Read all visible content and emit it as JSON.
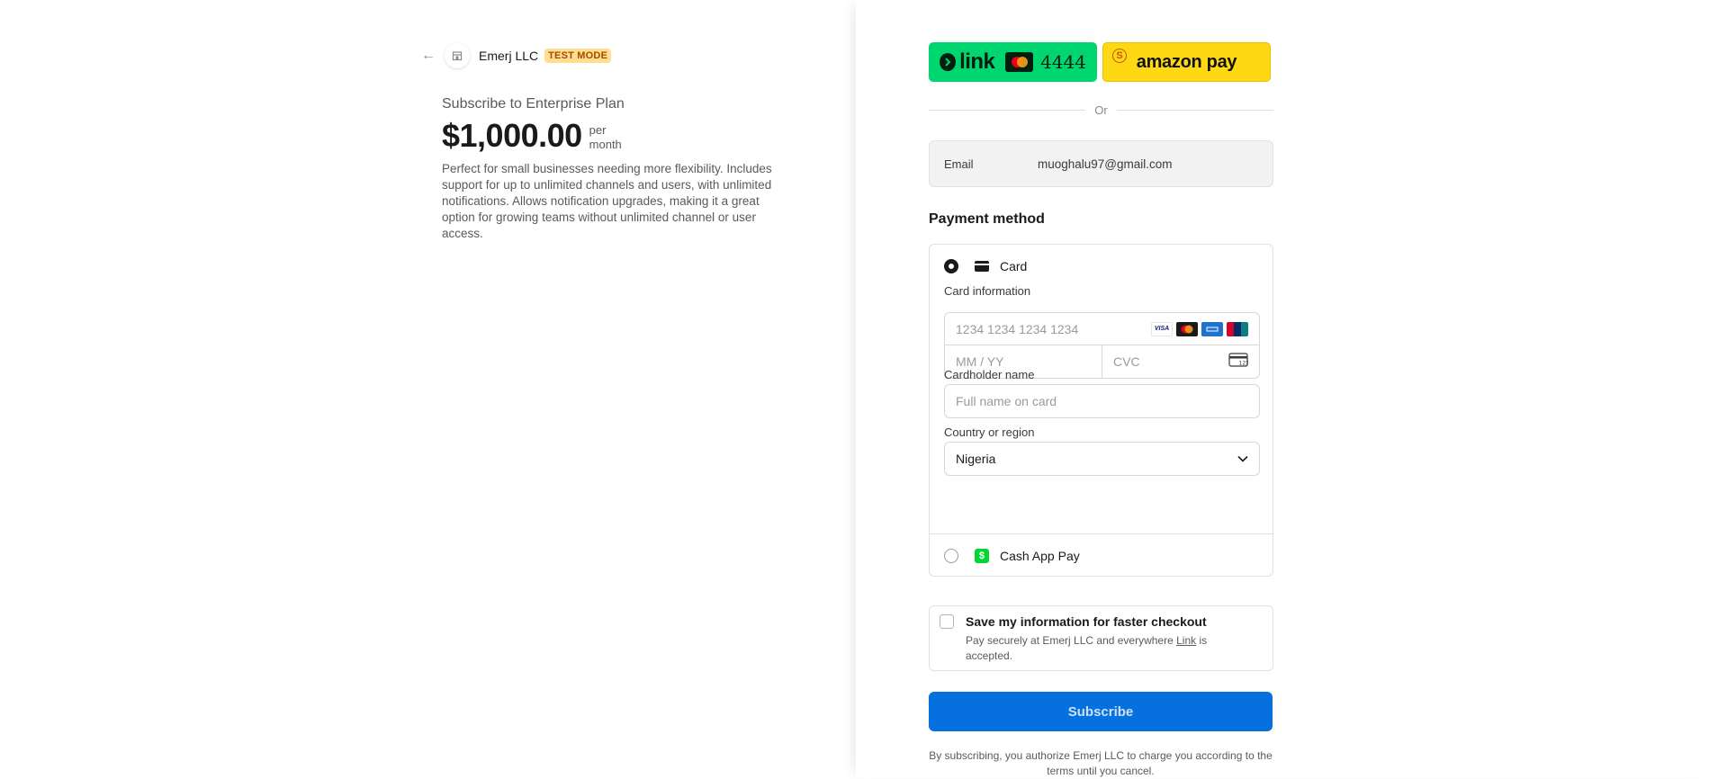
{
  "header": {
    "back_icon": "arrow-left-icon",
    "shop_icon": "storefront-icon",
    "merchant_name": "Emerj LLC",
    "test_badge": "TEST MODE"
  },
  "product": {
    "title": "Subscribe to Enterprise Plan",
    "price": "$1,000.00",
    "per": "per",
    "period": "month",
    "description": "Perfect for small businesses needing more flexibility. Includes support for up to unlimited channels and users, with unlimited notifications. Allows notification upgrades, making it a great option for growing teams without unlimited channel or user access."
  },
  "wallets": {
    "link": {
      "word": "link",
      "last4": "4444",
      "colors": {
        "bg": "#00d66f",
        "fg": "#011e0f"
      }
    },
    "amazon": {
      "word": "amazon pay",
      "badge": "S",
      "colors": {
        "bg": "#ffd814"
      }
    }
  },
  "divider": {
    "or": "Or"
  },
  "email": {
    "label": "Email",
    "value": "muoghalu97@gmail.com"
  },
  "payment": {
    "title": "Payment method",
    "card": {
      "label": "Card",
      "selected": true,
      "card_info_label": "Card information",
      "number_placeholder": "1234 1234 1234 1234",
      "brands": [
        "VISA",
        "mastercard",
        "amex",
        "unionpay"
      ],
      "expiry_placeholder": "MM / YY",
      "cvc_placeholder": "CVC",
      "cvc_icon_text": "123",
      "cardholder_label": "Cardholder name",
      "cardholder_placeholder": "Full name on card",
      "country_label": "Country or region",
      "country_value": "Nigeria"
    },
    "cashapp": {
      "label": "Cash App Pay",
      "selected": false,
      "icon_text": "$"
    }
  },
  "save": {
    "title": "Save my information for faster checkout",
    "sub_prefix": "Pay securely at Emerj LLC and everywhere ",
    "sub_link": "Link",
    "sub_suffix": " is accepted.",
    "checked": false
  },
  "subscribe": {
    "label": "Subscribe",
    "color": "#0570de"
  },
  "legal": {
    "text": "By subscribing, you authorize Emerj LLC to charge you according to the terms until you cancel."
  }
}
